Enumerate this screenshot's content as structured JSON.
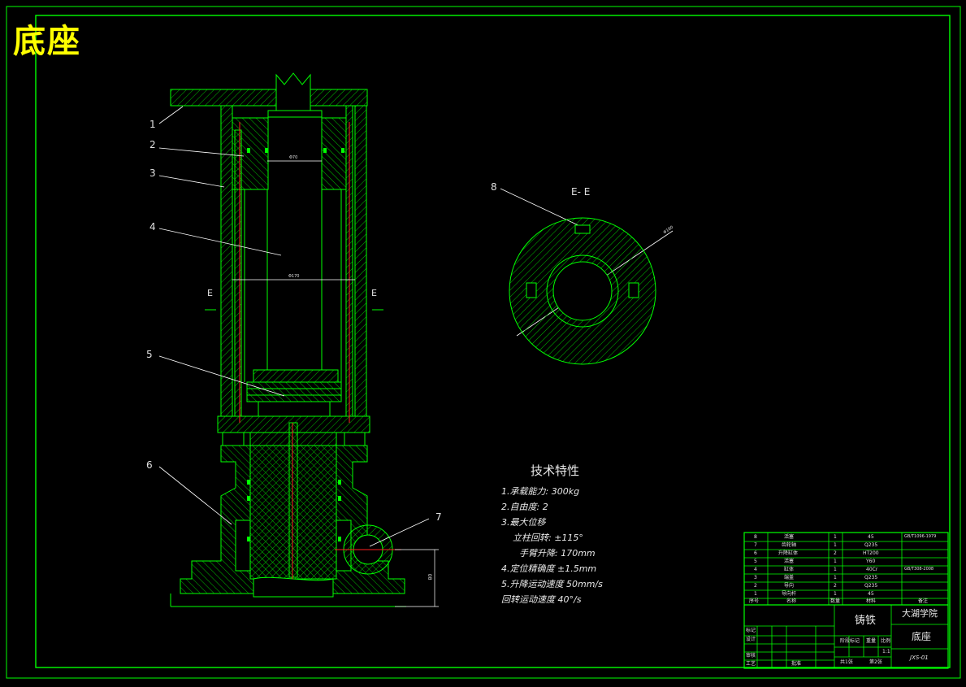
{
  "drawing": {
    "big_title": "底座",
    "section_label": "E- E",
    "section_marker_left": "E",
    "section_marker_right": "E",
    "dim_inner": "Φ70",
    "dim_outer": "Φ170",
    "dim_circle": "Φ180",
    "dim_height": "80",
    "part_numbers": [
      "1",
      "2",
      "3",
      "4",
      "5",
      "6",
      "7",
      "8"
    ]
  },
  "tech_spec": {
    "heading": "技术特性",
    "items": [
      "1.承载能力: 300kg",
      "2.自由度: 2",
      "3.最大位移",
      "立柱回转: ±115°",
      "手臂升降: 170mm",
      "4.定位精确度 ±1.5mm",
      "5.升降运动速度 50mm/s",
      "回转运动速度 40°/s"
    ]
  },
  "bom": {
    "rows": [
      {
        "no": "8",
        "name": "活塞",
        "qty": "1",
        "material": "45",
        "note": "GB/T1096-1979"
      },
      {
        "no": "7",
        "name": "齿轮轴",
        "qty": "1",
        "material": "Q235",
        "note": ""
      },
      {
        "no": "6",
        "name": "升降缸体",
        "qty": "2",
        "material": "HT200",
        "note": ""
      },
      {
        "no": "5",
        "name": "活塞",
        "qty": "1",
        "material": "Y60",
        "note": ""
      },
      {
        "no": "4",
        "name": "缸体",
        "qty": "1",
        "material": "40Cr",
        "note": "GB/T308-2008"
      },
      {
        "no": "3",
        "name": "端盖",
        "qty": "1",
        "material": "Q235",
        "note": ""
      },
      {
        "no": "2",
        "name": "导向",
        "qty": "2",
        "material": "Q235",
        "note": ""
      },
      {
        "no": "1",
        "name": "导向杆",
        "qty": "1",
        "material": "45",
        "note": ""
      }
    ],
    "header": {
      "no": "序号",
      "name": "名称",
      "qty": "数量",
      "material": "材料",
      "note": "备注"
    }
  },
  "title_block": {
    "material": "铸铁",
    "school": "大湖学院",
    "drawing_name": "底座",
    "drawing_no": "JXS-01",
    "scale": "1:1",
    "sheet_total": "共1张",
    "sheet_no": "第2张",
    "row_labels": [
      "标记",
      "设计",
      "审核",
      "工艺"
    ],
    "stage_label": "阶段标记",
    "weight_label": "重量",
    "scale_label": "比例",
    "approve_label": "批准"
  },
  "colors": {
    "background": "#000000",
    "frame": "#00ff00",
    "outline": "#00ff00",
    "hatch": "#00cc00",
    "center_line": "#ff2020",
    "leader": "#ffffff",
    "title": "#ffff00"
  }
}
